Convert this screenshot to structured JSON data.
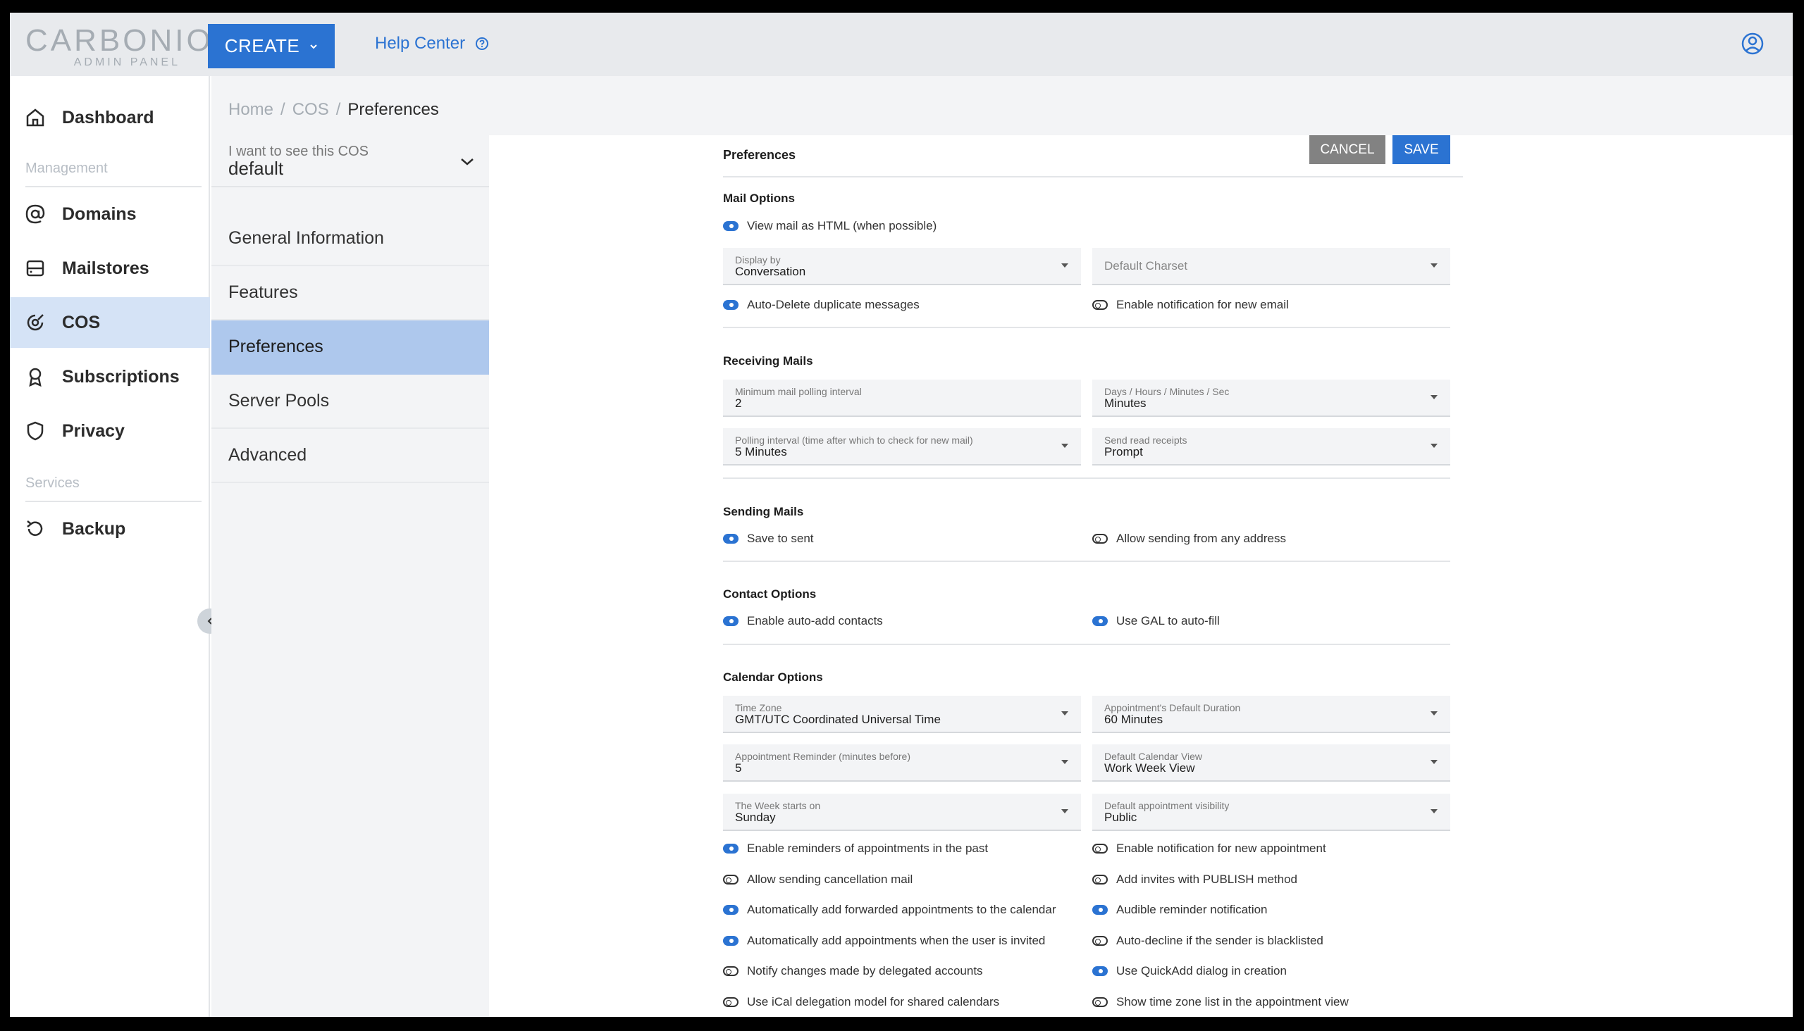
{
  "header": {
    "logo_main": "CARBONIO",
    "logo_sub": "ADMIN PANEL",
    "create_label": "CREATE",
    "help_label": "Help Center"
  },
  "leftnav": {
    "dashboard": "Dashboard",
    "management_label": "Management",
    "domains": "Domains",
    "mailstores": "Mailstores",
    "cos": "COS",
    "subscriptions": "Subscriptions",
    "privacy": "Privacy",
    "services_label": "Services",
    "backup": "Backup"
  },
  "breadcrumb": {
    "home": "Home",
    "sep1": "/",
    "cos": "COS",
    "sep2": "/",
    "current": "Preferences"
  },
  "subnav": {
    "cos_label": "I want to see this COS",
    "cos_value": "default",
    "items": [
      "General Information",
      "Features",
      "Preferences",
      "Server Pools",
      "Advanced"
    ]
  },
  "panel": {
    "title": "Preferences",
    "cancel": "CANCEL",
    "save": "SAVE"
  },
  "mail_options": {
    "title": "Mail Options",
    "view_html": "View mail as HTML (when possible)",
    "display_by_label": "Display by",
    "display_by_value": "Conversation",
    "default_charset_placeholder": "Default Charset",
    "auto_delete": "Auto-Delete duplicate messages",
    "notify_new_email": "Enable notification for new email"
  },
  "receiving": {
    "title": "Receiving Mails",
    "min_interval_label": "Minimum mail polling interval",
    "min_interval_value": "2",
    "unit_label": "Days / Hours / Minutes / Sec",
    "unit_value": "Minutes",
    "polling_label": "Polling interval (time after which to check for new mail)",
    "polling_value": "5 Minutes",
    "read_receipts_label": "Send read receipts",
    "read_receipts_value": "Prompt"
  },
  "sending": {
    "title": "Sending Mails",
    "save_sent": "Save to sent",
    "allow_any": "Allow sending from any address"
  },
  "contacts": {
    "title": "Contact Options",
    "auto_add": "Enable auto-add contacts",
    "use_gal": "Use GAL to auto-fill"
  },
  "calendar": {
    "title": "Calendar Options",
    "timezone_label": "Time Zone",
    "timezone_value": "GMT/UTC Coordinated Universal Time",
    "duration_label": "Appointment's Default Duration",
    "duration_value": "60 Minutes",
    "reminder_label": "Appointment Reminder (minutes before)",
    "reminder_value": "5",
    "view_label": "Default Calendar View",
    "view_value": "Work Week View",
    "week_label": "The Week starts on",
    "week_value": "Sunday",
    "visibility_label": "Default appointment visibility",
    "visibility_value": "Public",
    "toggles_left": [
      {
        "label": "Enable reminders of appointments in the past",
        "on": true
      },
      {
        "label": "Allow sending cancellation mail",
        "on": false
      },
      {
        "label": "Automatically add forwarded appointments to the calendar",
        "on": true
      },
      {
        "label": "Automatically add appointments when the user is invited",
        "on": true
      },
      {
        "label": "Notify changes made by delegated accounts",
        "on": false
      },
      {
        "label": "Use iCal delegation model for shared calendars",
        "on": false
      }
    ],
    "toggles_right": [
      {
        "label": "Enable notification for new appointment",
        "on": false
      },
      {
        "label": "Add invites with PUBLISH method",
        "on": false
      },
      {
        "label": "Audible reminder notification",
        "on": true
      },
      {
        "label": "Auto-decline if the sender is blacklisted",
        "on": false
      },
      {
        "label": "Use QuickAdd dialog in creation",
        "on": true
      },
      {
        "label": "Show time zone list in the appointment view",
        "on": false
      }
    ]
  },
  "colors": {
    "accent": "#2b73d2",
    "active_nav": "#d5e3f6",
    "active_sub": "#aec8ed"
  }
}
